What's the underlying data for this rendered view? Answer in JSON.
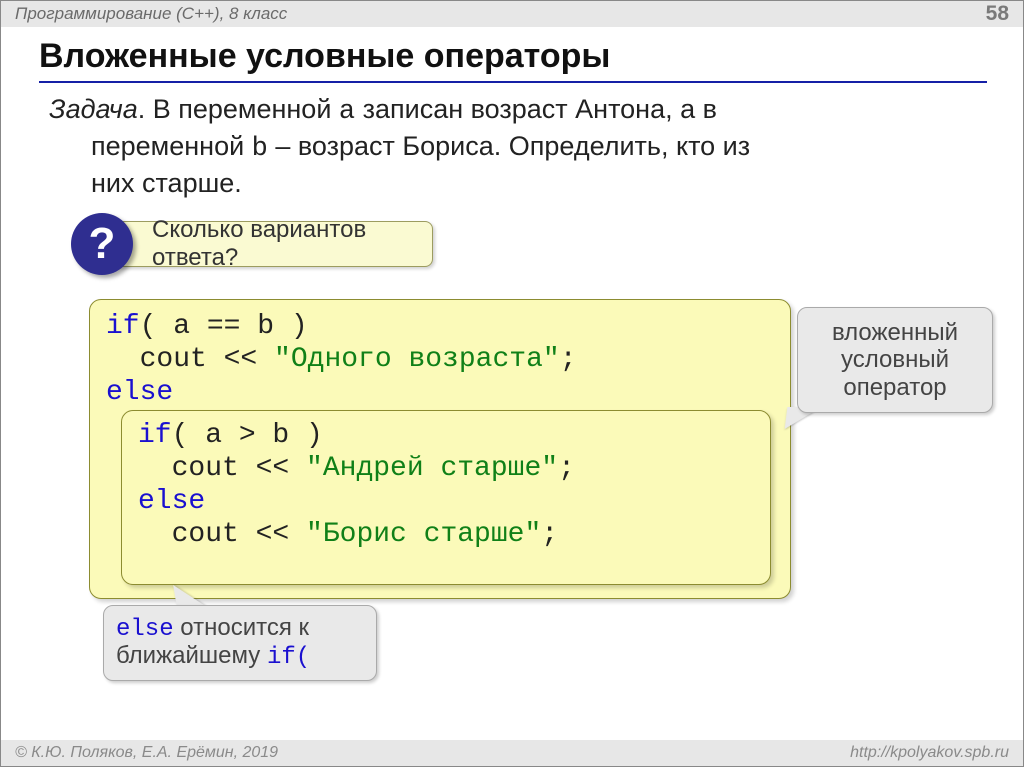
{
  "header": {
    "left": "Программирование (C++), 8 класс",
    "page": "58"
  },
  "title": "Вложенные условные операторы",
  "task": {
    "label": "Задача",
    "line1_a": ". В переменной ",
    "var_a": "a",
    "line1_b": " записан возраст Антона, а в",
    "line2_a": "переменной ",
    "var_b": "b",
    "line2_b": " – возраст Бориса. Определить, кто из",
    "line3": "них старше."
  },
  "question": {
    "mark": "?",
    "text": "Сколько вариантов ответа?"
  },
  "code_outer": {
    "l1a": "if",
    "l1b": "( a == b )",
    "l2a": "  cout << ",
    "l2s": "\"Одного возраста\"",
    "l2b": ";",
    "l3": "else"
  },
  "code_inner": {
    "l1a": "if",
    "l1b": "( a > b )",
    "l2a": "  cout << ",
    "l2s": "\"Андрей старше\"",
    "l2b": ";",
    "l3": "else",
    "l4a": "  cout << ",
    "l4s": "\"Борис старше\"",
    "l4b": ";"
  },
  "callout_right": "вложенный условный оператор",
  "callout_btm": {
    "kw1": "else",
    "mid": " относится к ближайшему ",
    "kw2": "if("
  },
  "footer": {
    "left": "© К.Ю. Поляков, Е.А. Ерёмин, 2019",
    "right": "http://kpolyakov.spb.ru"
  }
}
